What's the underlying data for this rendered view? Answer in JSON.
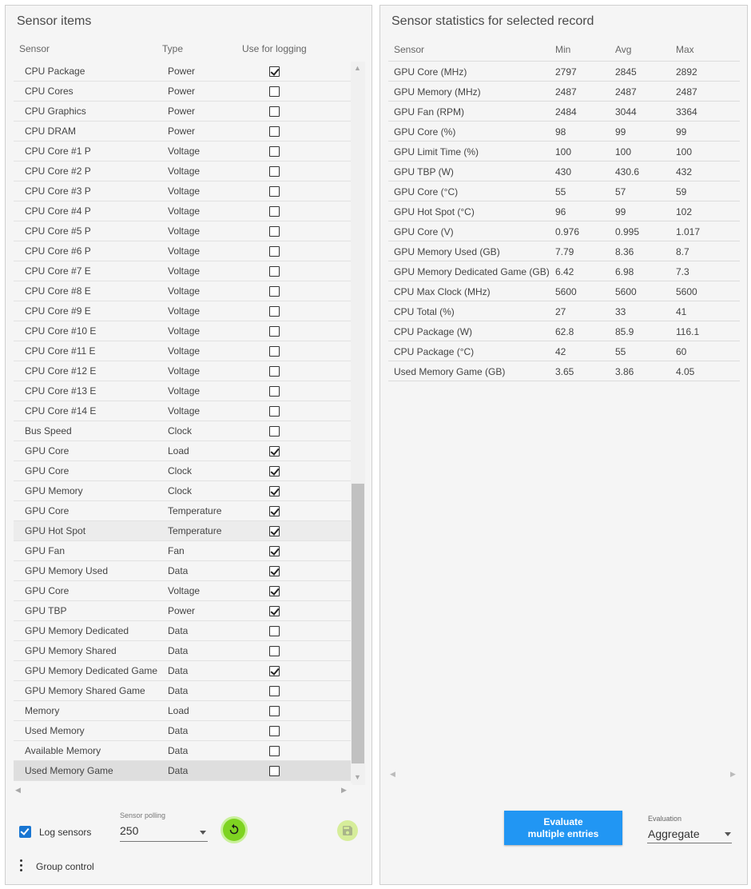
{
  "left": {
    "title": "Sensor items",
    "headers": {
      "sensor": "Sensor",
      "type": "Type",
      "use": "Use for logging"
    },
    "rows": [
      {
        "sensor": "CPU Package",
        "type": "Power",
        "checked": true
      },
      {
        "sensor": "CPU Cores",
        "type": "Power",
        "checked": false
      },
      {
        "sensor": "CPU Graphics",
        "type": "Power",
        "checked": false
      },
      {
        "sensor": "CPU DRAM",
        "type": "Power",
        "checked": false
      },
      {
        "sensor": "CPU Core #1 P",
        "type": "Voltage",
        "checked": false
      },
      {
        "sensor": "CPU Core #2 P",
        "type": "Voltage",
        "checked": false
      },
      {
        "sensor": "CPU Core #3 P",
        "type": "Voltage",
        "checked": false
      },
      {
        "sensor": "CPU Core #4 P",
        "type": "Voltage",
        "checked": false
      },
      {
        "sensor": "CPU Core #5 P",
        "type": "Voltage",
        "checked": false
      },
      {
        "sensor": "CPU Core #6 P",
        "type": "Voltage",
        "checked": false
      },
      {
        "sensor": "CPU Core #7 E",
        "type": "Voltage",
        "checked": false
      },
      {
        "sensor": "CPU Core #8 E",
        "type": "Voltage",
        "checked": false
      },
      {
        "sensor": "CPU Core #9 E",
        "type": "Voltage",
        "checked": false
      },
      {
        "sensor": "CPU Core #10 E",
        "type": "Voltage",
        "checked": false
      },
      {
        "sensor": "CPU Core #11 E",
        "type": "Voltage",
        "checked": false
      },
      {
        "sensor": "CPU Core #12 E",
        "type": "Voltage",
        "checked": false
      },
      {
        "sensor": "CPU Core #13 E",
        "type": "Voltage",
        "checked": false
      },
      {
        "sensor": "CPU Core #14 E",
        "type": "Voltage",
        "checked": false
      },
      {
        "sensor": "Bus Speed",
        "type": "Clock",
        "checked": false
      },
      {
        "sensor": "GPU Core",
        "type": "Load",
        "checked": true
      },
      {
        "sensor": "GPU Core",
        "type": "Clock",
        "checked": true
      },
      {
        "sensor": "GPU Memory",
        "type": "Clock",
        "checked": true
      },
      {
        "sensor": "GPU Core",
        "type": "Temperature",
        "checked": true
      },
      {
        "sensor": "GPU Hot Spot",
        "type": "Temperature",
        "checked": true,
        "state": "hover"
      },
      {
        "sensor": "GPU Fan",
        "type": "Fan",
        "checked": true
      },
      {
        "sensor": "GPU Memory Used",
        "type": "Data",
        "checked": true
      },
      {
        "sensor": "GPU Core",
        "type": "Voltage",
        "checked": true
      },
      {
        "sensor": "GPU TBP",
        "type": "Power",
        "checked": true
      },
      {
        "sensor": "GPU Memory Dedicated",
        "type": "Data",
        "checked": false
      },
      {
        "sensor": "GPU Memory Shared",
        "type": "Data",
        "checked": false
      },
      {
        "sensor": "GPU Memory Dedicated Game",
        "type": "Data",
        "checked": true
      },
      {
        "sensor": "GPU Memory Shared Game",
        "type": "Data",
        "checked": false
      },
      {
        "sensor": "Memory",
        "type": "Load",
        "checked": false
      },
      {
        "sensor": "Used Memory",
        "type": "Data",
        "checked": false
      },
      {
        "sensor": "Available Memory",
        "type": "Data",
        "checked": false
      },
      {
        "sensor": "Used Memory Game",
        "type": "Data",
        "checked": false,
        "state": "selected"
      }
    ],
    "log_sensors_label": "Log sensors",
    "log_sensors_checked": true,
    "polling_label": "Sensor polling",
    "polling_value": "250",
    "group_control_label": "Group control"
  },
  "right": {
    "title": "Sensor statistics for selected record",
    "headers": {
      "sensor": "Sensor",
      "min": "Min",
      "avg": "Avg",
      "max": "Max"
    },
    "rows": [
      {
        "sensor": "GPU Core (MHz)",
        "min": "2797",
        "avg": "2845",
        "max": "2892"
      },
      {
        "sensor": "GPU Memory (MHz)",
        "min": "2487",
        "avg": "2487",
        "max": "2487"
      },
      {
        "sensor": "GPU Fan (RPM)",
        "min": "2484",
        "avg": "3044",
        "max": "3364"
      },
      {
        "sensor": "GPU Core (%)",
        "min": "98",
        "avg": "99",
        "max": "99"
      },
      {
        "sensor": "GPU Limit Time (%)",
        "min": "100",
        "avg": "100",
        "max": "100"
      },
      {
        "sensor": "GPU TBP (W)",
        "min": "430",
        "avg": "430.6",
        "max": "432"
      },
      {
        "sensor": "GPU Core (°C)",
        "min": "55",
        "avg": "57",
        "max": "59"
      },
      {
        "sensor": "GPU Hot Spot (°C)",
        "min": "96",
        "avg": "99",
        "max": "102"
      },
      {
        "sensor": "GPU Core (V)",
        "min": "0.976",
        "avg": "0.995",
        "max": "1.017"
      },
      {
        "sensor": "GPU Memory Used (GB)",
        "min": "7.79",
        "avg": "8.36",
        "max": "8.7"
      },
      {
        "sensor": "GPU Memory Dedicated Game (GB)",
        "min": "6.42",
        "avg": "6.98",
        "max": "7.3"
      },
      {
        "sensor": "CPU Max Clock (MHz)",
        "min": "5600",
        "avg": "5600",
        "max": "5600"
      },
      {
        "sensor": "CPU Total (%)",
        "min": "27",
        "avg": "33",
        "max": "41"
      },
      {
        "sensor": "CPU Package (W)",
        "min": "62.8",
        "avg": "85.9",
        "max": "116.1"
      },
      {
        "sensor": "CPU Package (°C)",
        "min": "42",
        "avg": "55",
        "max": "60"
      },
      {
        "sensor": "Used Memory Game (GB)",
        "min": "3.65",
        "avg": "3.86",
        "max": "4.05"
      }
    ],
    "evaluate_button_line1": "Evaluate",
    "evaluate_button_line2": "multiple entries",
    "evaluation_label": "Evaluation",
    "evaluation_value": "Aggregate"
  },
  "colors": {
    "accent": "#2196f3",
    "checkbox": "#1976d2",
    "refresh": "#7ed321"
  },
  "icons": {
    "refresh": "refresh-icon",
    "save": "save-icon",
    "more": "more-vert-icon"
  }
}
